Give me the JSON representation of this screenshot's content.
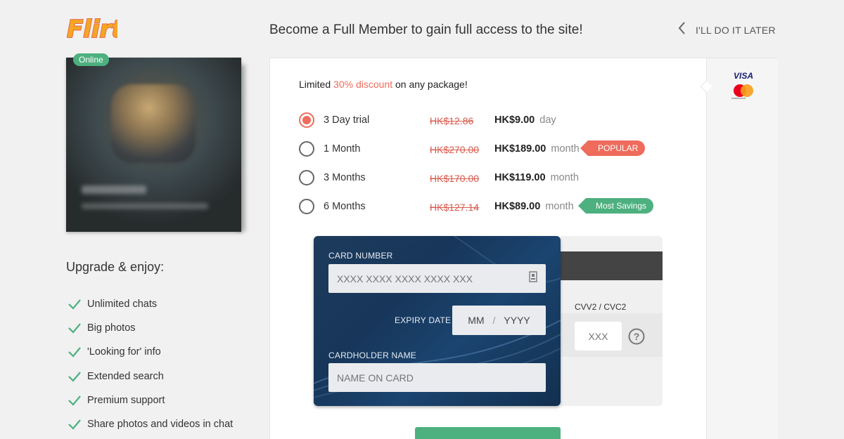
{
  "brand": {
    "logo_text": "Flirt"
  },
  "header": {
    "title": "Become a Full Member to gain full access to the site!",
    "later_label": "I'LL DO IT LATER"
  },
  "profile": {
    "online_label": "Online"
  },
  "benefits": {
    "title": "Upgrade & enjoy:",
    "items": [
      "Unlimited chats",
      "Big photos",
      "'Looking for' info",
      "Extended search",
      "Premium support",
      "Share photos and videos in chat"
    ]
  },
  "offer": {
    "prefix": "Limited ",
    "highlight": "30% discount",
    "suffix": " on any package!"
  },
  "plans": [
    {
      "name": "3 Day trial",
      "old_price": "HK$12.86",
      "price": "HK$9.00",
      "unit": "day",
      "selected": true,
      "tag": ""
    },
    {
      "name": "1 Month",
      "old_price": "HK$270.00",
      "price": "HK$189.00",
      "unit": "month",
      "selected": false,
      "tag": "POPULAR"
    },
    {
      "name": "3 Months",
      "old_price": "HK$170.00",
      "price": "HK$119.00",
      "unit": "month",
      "selected": false,
      "tag": ""
    },
    {
      "name": "6 Months",
      "old_price": "HK$127.14",
      "price": "HK$89.00",
      "unit": "month",
      "selected": false,
      "tag": "Most Savings"
    }
  ],
  "card": {
    "number_label": "CARD NUMBER",
    "number_placeholder": "XXXX XXXX XXXX XXXX XXX",
    "expiry_label": "EXPIRY DATE",
    "month_placeholder": "MM",
    "year_placeholder": "YYYY",
    "expiry_separator": "/",
    "holder_label": "CARDHOLDER NAME",
    "holder_placeholder": "NAME ON CARD",
    "cvv_label": "CVV2 / CVC2",
    "cvv_placeholder": "XXX"
  },
  "payment_brands": {
    "visa": "VISA",
    "mastercard": "mastercard"
  },
  "colors": {
    "accent": "#ef6b5b",
    "success": "#4db07f",
    "card_bg": "#1d3b5c"
  },
  "icons": {
    "back": "chevron-left-icon",
    "check": "check-icon",
    "card": "card-icon",
    "help": "question-circle-icon"
  }
}
